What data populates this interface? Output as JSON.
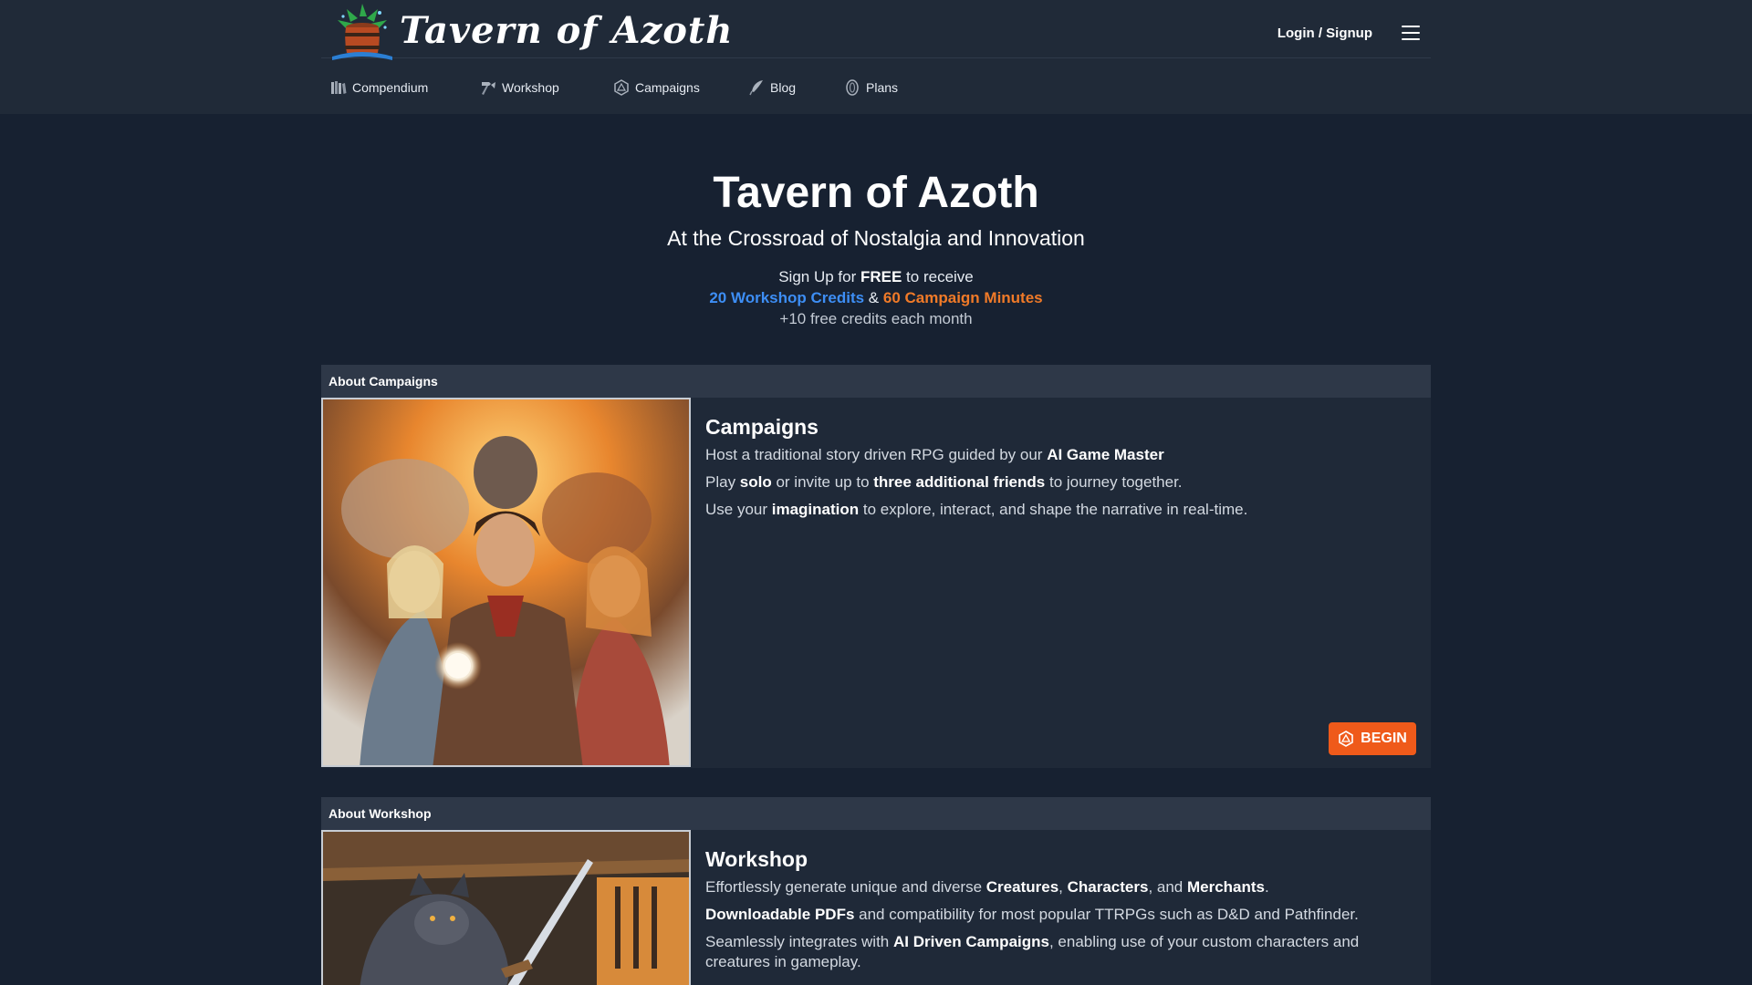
{
  "brand": {
    "name": "Tavern of Azoth"
  },
  "header": {
    "login_label": "Login / Signup",
    "nav": [
      {
        "label": "Compendium",
        "icon": "books-icon"
      },
      {
        "label": "Workshop",
        "icon": "hammer-icon"
      },
      {
        "label": "Campaigns",
        "icon": "d20-icon"
      },
      {
        "label": "Blog",
        "icon": "quill-icon"
      },
      {
        "label": "Plans",
        "icon": "coin-icon"
      }
    ]
  },
  "hero": {
    "title": "Tavern of Azoth",
    "subtitle": "At the Crossroad of Nostalgia and Innovation",
    "promo_prefix": "Sign Up for ",
    "promo_free": "FREE",
    "promo_suffix": " to receive",
    "workshop_credits": "20 Workshop Credits",
    "amp": " & ",
    "campaign_minutes": "60 Campaign Minutes",
    "monthly": "+10 free credits each month"
  },
  "campaigns": {
    "header": "About Campaigns",
    "title": "Campaigns",
    "l1_a": "Host a traditional story driven RPG guided by our ",
    "l1_b": "AI Game Master",
    "l2_a": "Play ",
    "l2_b": "solo",
    "l2_c": " or invite up to ",
    "l2_d": "three additional friends",
    "l2_e": " to journey together.",
    "l3_a": "Use your ",
    "l3_b": "imagination",
    "l3_c": " to explore, interact, and shape the narrative in real-time.",
    "begin_label": "BEGIN"
  },
  "workshop": {
    "header": "About Workshop",
    "title": "Workshop",
    "l1_a": "Effortlessly generate unique and diverse ",
    "l1_b": "Creatures",
    "l1_c": ", ",
    "l1_d": "Characters",
    "l1_e": ", and ",
    "l1_f": "Merchants",
    "l1_g": ".",
    "l2_a": "Downloadable PDFs",
    "l2_b": " and compatibility for most popular TTRPGs such as D&D and Pathfinder.",
    "l3_a": "Seamlessly integrates with ",
    "l3_b": "AI Driven Campaigns",
    "l3_c": ", enabling use of your custom characters and creatures in gameplay."
  },
  "colors": {
    "background": "#172131",
    "header": "#202a38",
    "accent_blue": "#3d8ef5",
    "accent_orange": "#f07a28",
    "button": "#ef5a1a"
  }
}
